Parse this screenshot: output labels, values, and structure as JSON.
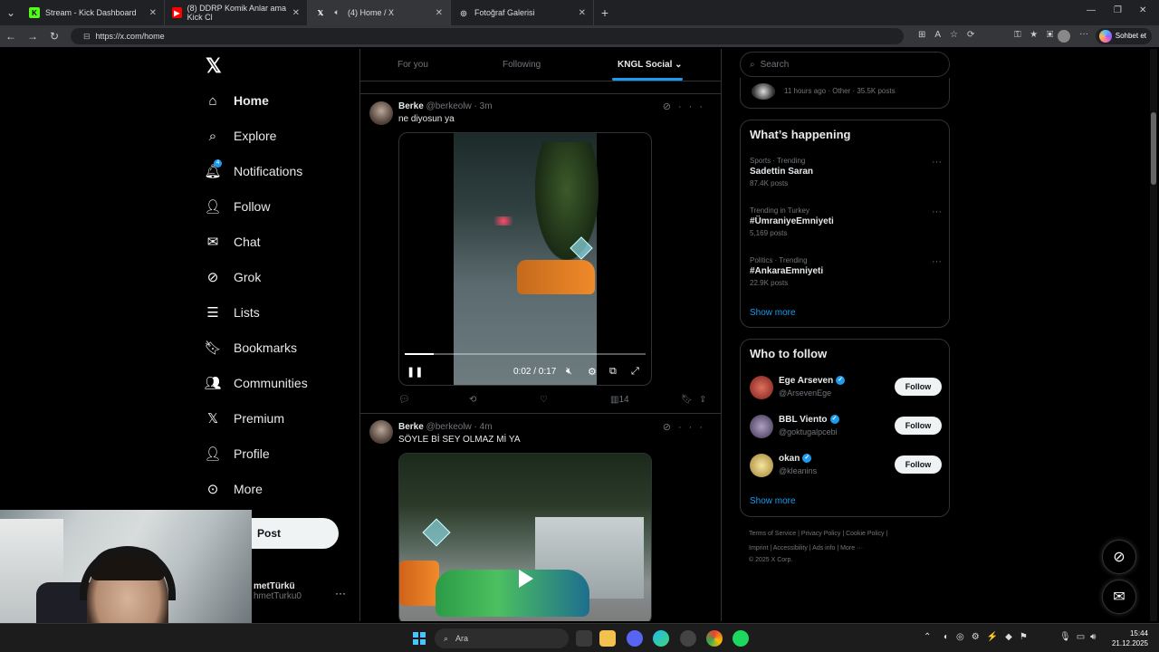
{
  "browser": {
    "tabs": [
      {
        "label": "Stream - Kick Dashboard",
        "icon": "kick-icon",
        "color": "#53fc18"
      },
      {
        "label": "(8) DDRP Komik Anlar ama Kick Cl",
        "icon": "youtube-icon",
        "color": "#ff0000"
      },
      {
        "label": "(4) Home / X",
        "icon": "x-icon",
        "color": "#ffffff"
      },
      {
        "label": "Fotoğraf Galerisi",
        "icon": "globe-icon",
        "color": "#cccccc"
      }
    ],
    "url": "https://x.com/home",
    "chat_button": "Sohbet et"
  },
  "sidebar": {
    "items": [
      {
        "label": "Home",
        "icon": "home-icon"
      },
      {
        "label": "Explore",
        "icon": "search-icon"
      },
      {
        "label": "Notifications",
        "icon": "bell-icon",
        "badge": "4"
      },
      {
        "label": "Follow",
        "icon": "person-add-icon"
      },
      {
        "label": "Chat",
        "icon": "mail-icon"
      },
      {
        "label": "Grok",
        "icon": "grok-icon"
      },
      {
        "label": "Lists",
        "icon": "list-icon"
      },
      {
        "label": "Bookmarks",
        "icon": "bookmark-icon"
      },
      {
        "label": "Communities",
        "icon": "communities-icon"
      },
      {
        "label": "Premium",
        "icon": "x-icon"
      },
      {
        "label": "Profile",
        "icon": "profile-icon"
      },
      {
        "label": "More",
        "icon": "more-icon"
      }
    ],
    "post_label": "Post",
    "account_name": "metTürkü",
    "account_handle": "hmetTurku0"
  },
  "timeline": {
    "tabs": [
      {
        "label": "For you"
      },
      {
        "label": "Following"
      },
      {
        "label": "KNGL Social"
      }
    ],
    "tweets": [
      {
        "name": "Berke",
        "handle": "@berkeolw",
        "time": "· 3m",
        "text": "ne diyosun ya",
        "video_time": "0:02 / 0:17",
        "progress": 0.12,
        "views": "14"
      },
      {
        "name": "Berke",
        "handle": "@berkeolw",
        "time": "· 4m",
        "text": "SÖYLE Bİ SEY OLMAZ Mİ YA"
      }
    ]
  },
  "right": {
    "search_placeholder": "Search",
    "prev_meta": "11 hours ago · Other · 35.5K posts",
    "happening_title": "What’s happening",
    "trends": [
      {
        "context": "Sports · Trending",
        "title": "Sadettin Saran",
        "count": "87.4K posts"
      },
      {
        "context": "Trending in Turkey",
        "title": "#ÜmraniyeEmniyeti",
        "count": "5,169 posts"
      },
      {
        "context": "Politics · Trending",
        "title": "#AnkaraEmniyeti",
        "count": "22.9K posts"
      }
    ],
    "show_more": "Show more",
    "who_title": "Who to follow",
    "who": [
      {
        "name": "Ege Arseven",
        "handle": "@ArsevenEge",
        "button": "Follow",
        "color": "#b03a2e"
      },
      {
        "name": "BBL Viento",
        "handle": "@goktugalpcebi",
        "button": "Follow",
        "color": "#6a6a8a"
      },
      {
        "name": "okan",
        "handle": "@kleanins",
        "button": "Follow",
        "color": "#e0c070"
      }
    ],
    "footer_line1": "Terms of Service  |  Privacy Policy  |  Cookie Policy  |",
    "footer_line2": "Imprint  |  Accessibility  |  Ads info  |  More ···",
    "footer_line3": "© 2025 X Corp."
  },
  "taskbar": {
    "search": "Ara",
    "time": "15:44",
    "date": "21.12.2025"
  }
}
